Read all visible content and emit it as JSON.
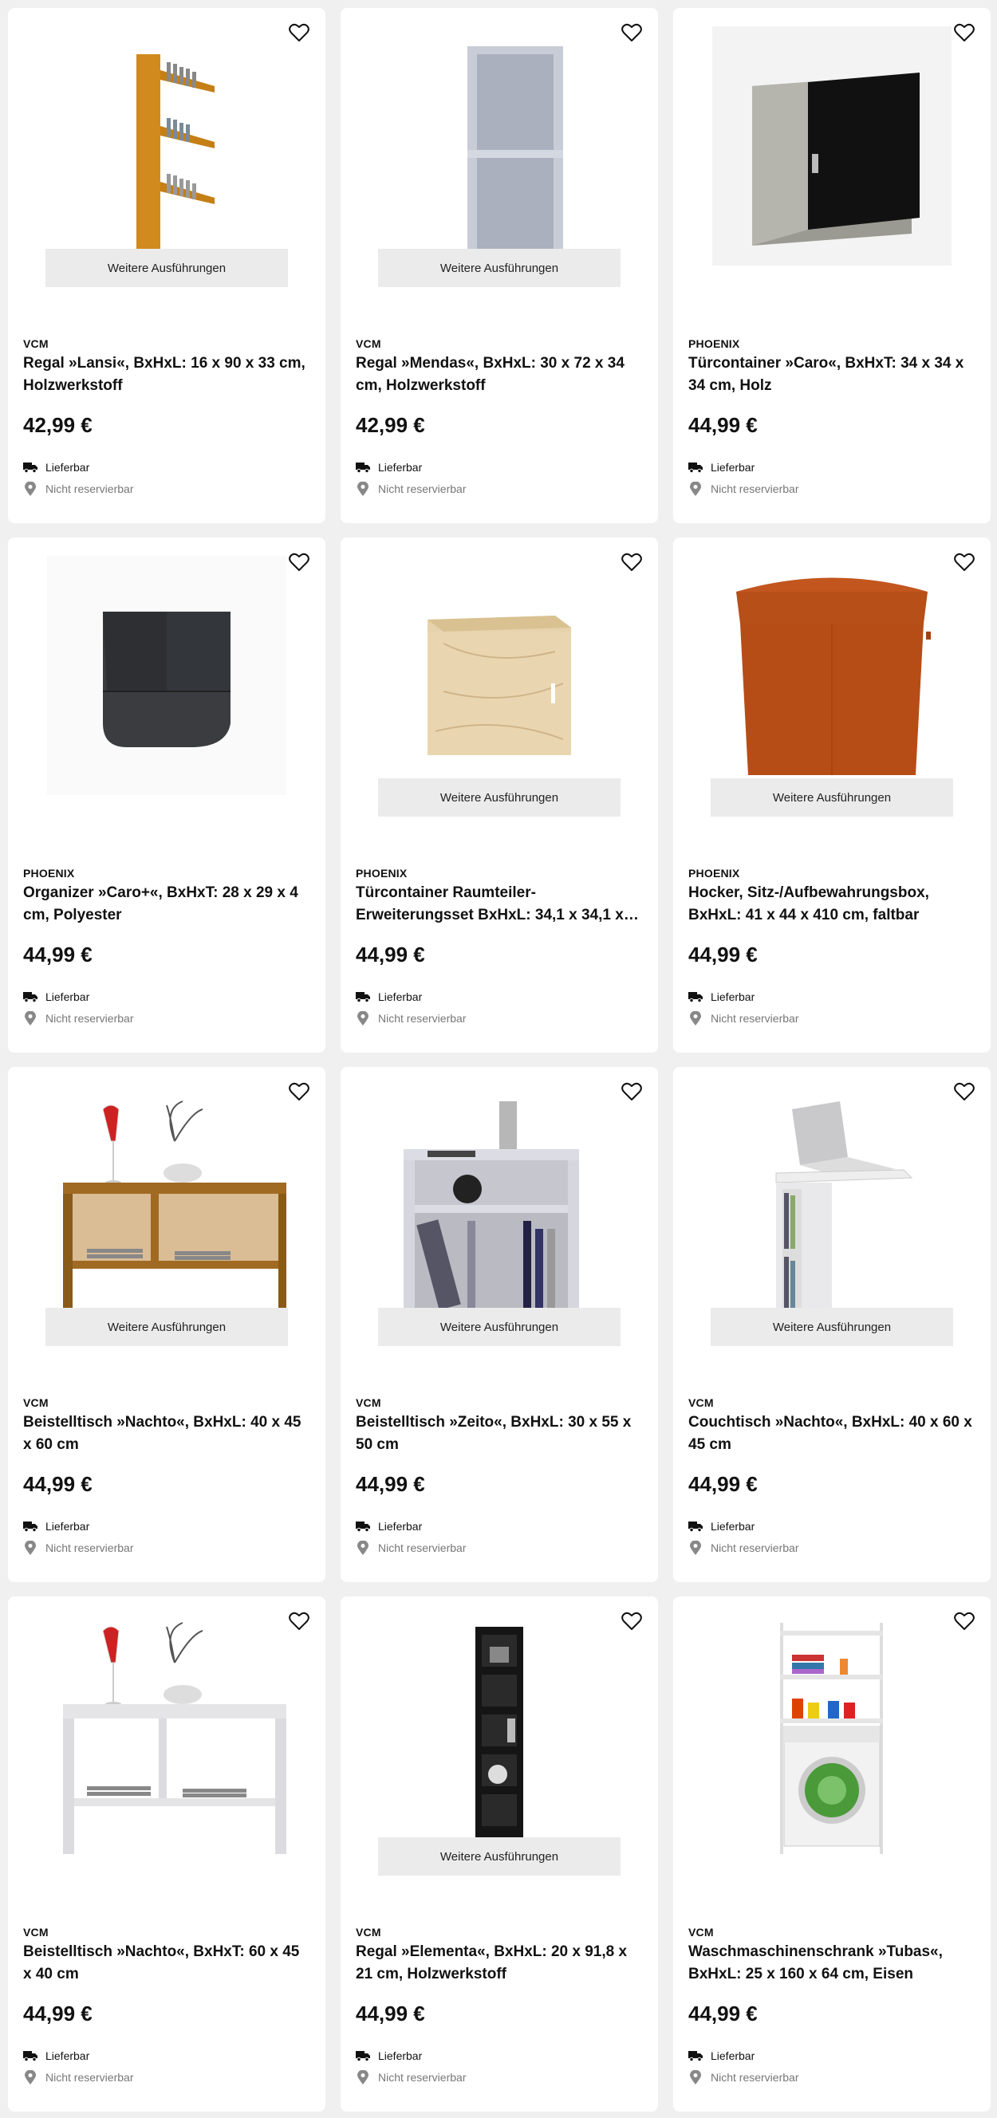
{
  "ui": {
    "variants_label": "Weitere Ausführungen",
    "delivery_label": "Lieferbar",
    "reserve_label": "Nicht reservierbar"
  },
  "products": [
    {
      "brand": "VCM",
      "title": "Regal »Lansi«, BxHxL: 16 x 90 x 33 cm, Holzwerkstoff",
      "price": "42,99 €",
      "has_variants": true,
      "image": "cd-wall-shelf"
    },
    {
      "brand": "VCM",
      "title": "Regal »Mendas«, BxHxL: 30 x 72 x 34 cm, Holzwerkstoff",
      "price": "42,99 €",
      "has_variants": true,
      "image": "grey-shelf"
    },
    {
      "brand": "PHOENIX",
      "title": "Türcontainer »Caro«, BxHxT: 34 x 34 x 34 cm, Holz",
      "price": "44,99 €",
      "has_variants": false,
      "image": "cube-door"
    },
    {
      "brand": "PHOENIX",
      "title": "Organizer »Caro+«, BxHxT: 28 x 29 x 4 cm, Polyester",
      "price": "44,99 €",
      "has_variants": false,
      "image": "organizer"
    },
    {
      "brand": "PHOENIX",
      "title": "Türcontainer Raumteiler-Erweiterungsset BxHxL: 34,1 x 34,1 x…",
      "price": "44,99 €",
      "has_variants": true,
      "image": "oak-cube"
    },
    {
      "brand": "PHOENIX",
      "title": "Hocker, Sitz-/Aufbewahrungsbox, BxHxL: 41 x 44 x 410 cm, faltbar",
      "price": "44,99 €",
      "has_variants": true,
      "image": "stool-box"
    },
    {
      "brand": "VCM",
      "title": "Beistelltisch »Nachto«, BxHxL: 40 x 45 x 60 cm",
      "price": "44,99 €",
      "has_variants": true,
      "image": "side-table-wood"
    },
    {
      "brand": "VCM",
      "title": "Beistelltisch »Zeito«, BxHxL: 30 x 55 x 50 cm",
      "price": "44,99 €",
      "has_variants": true,
      "image": "side-table-zeito"
    },
    {
      "brand": "VCM",
      "title": "Couchtisch »Nachto«, BxHxL: 40 x 60 x 45 cm",
      "price": "44,99 €",
      "has_variants": true,
      "image": "laptop-table"
    },
    {
      "brand": "VCM",
      "title": "Beistelltisch »Nachto«, BxHxT: 60 x 45 x 40 cm",
      "price": "44,99 €",
      "has_variants": false,
      "image": "side-table-white"
    },
    {
      "brand": "VCM",
      "title": "Regal »Elementa«, BxHxL: 20 x 91,8 x 21 cm, Holzwerkstoff",
      "price": "44,99 €",
      "has_variants": true,
      "image": "black-tall-shelf"
    },
    {
      "brand": "VCM",
      "title": "Waschmaschinenschrank »Tubas«, BxHxL: 25 x 160 x 64 cm, Eisen",
      "price": "44,99 €",
      "has_variants": false,
      "image": "washer-rack"
    }
  ]
}
